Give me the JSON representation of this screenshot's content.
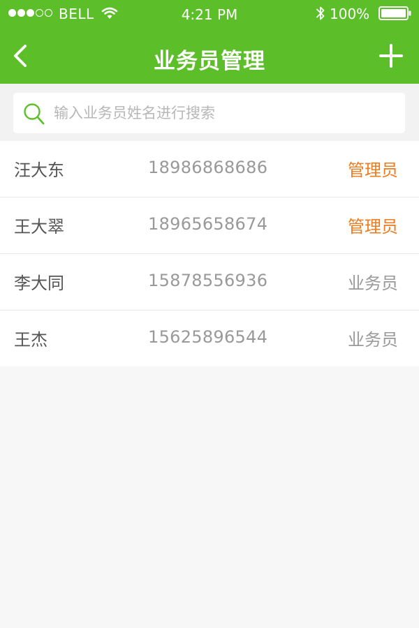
{
  "status_bar": {
    "carrier": "BELL",
    "time": "4:21 PM",
    "battery": "100%"
  },
  "nav": {
    "title": "业务员管理",
    "back_icon": "chevron-left-icon",
    "add_icon": "plus-icon"
  },
  "search": {
    "placeholder": "输入业务员姓名进行搜索",
    "value": "",
    "icon": "search-icon"
  },
  "colors": {
    "brand_green": "#5cbf2a",
    "admin_orange": "#ee7b1c",
    "muted_text": "#999999"
  },
  "salespeople": [
    {
      "name": "汪大东",
      "phone": "18986868686",
      "role": "管理员",
      "is_admin": true
    },
    {
      "name": "王大翠",
      "phone": "18965658674",
      "role": "管理员",
      "is_admin": true
    },
    {
      "name": "李大同",
      "phone": "15878556936",
      "role": "业务员",
      "is_admin": false
    },
    {
      "name": "王杰",
      "phone": "15625896544",
      "role": "业务员",
      "is_admin": false
    }
  ]
}
